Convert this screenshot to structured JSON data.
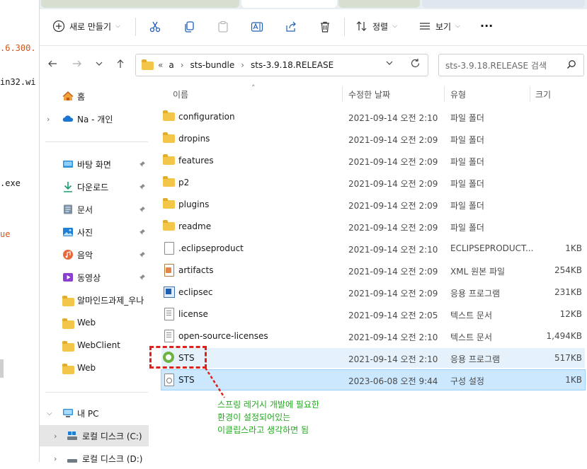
{
  "editor": {
    "lines": [
      {
        "text": ".6.300.",
        "color": "#d1561c"
      },
      {
        "text": "in32.wi",
        "color": "#1a1a1a"
      },
      {
        "text": ".exe",
        "color": "#1a1a1a"
      },
      {
        "text": "ue",
        "color": "#d1561c"
      }
    ]
  },
  "toolbar": {
    "new_label": "새로 만들기",
    "sort_label": "정렬",
    "view_label": "보기",
    "more_label": "···"
  },
  "address": {
    "prefix": "«",
    "crumbs": [
      "a",
      "sts-bundle",
      "sts-3.9.18.RELEASE"
    ],
    "search_placeholder": "sts-3.9.18.RELEASE 검색"
  },
  "sidebar": {
    "home": "홈",
    "cloud": "Na - 개인",
    "quick": [
      {
        "label": "바탕 화면",
        "icon": "desktop-icon",
        "pinned": true
      },
      {
        "label": "다운로드",
        "icon": "download-icon",
        "pinned": true
      },
      {
        "label": "문서",
        "icon": "documents-icon",
        "pinned": true
      },
      {
        "label": "사진",
        "icon": "pictures-icon",
        "pinned": true
      },
      {
        "label": "음악",
        "icon": "music-icon",
        "pinned": true
      },
      {
        "label": "동영상",
        "icon": "videos-icon",
        "pinned": true
      },
      {
        "label": "알마인드과제_우나",
        "icon": "folder-icon",
        "pinned": false
      },
      {
        "label": "Web",
        "icon": "folder-icon",
        "pinned": false
      },
      {
        "label": "WebClient",
        "icon": "folder-icon",
        "pinned": false
      },
      {
        "label": "Web",
        "icon": "folder-icon",
        "pinned": false
      }
    ],
    "this_pc": "내 PC",
    "drive_c": "로컬 디스크 (C:)",
    "drive_d": "로컬 디스크 (D:)"
  },
  "columns": {
    "name": "이름",
    "date": "수정한 날짜",
    "type": "유형",
    "size": "크기"
  },
  "files": [
    {
      "name": "configuration",
      "date": "2021-09-14 오전 2:10",
      "type": "파일 폴더",
      "size": "",
      "icon": "folder-icon"
    },
    {
      "name": "dropins",
      "date": "2021-09-14 오전 2:09",
      "type": "파일 폴더",
      "size": "",
      "icon": "folder-icon"
    },
    {
      "name": "features",
      "date": "2021-09-14 오전 2:09",
      "type": "파일 폴더",
      "size": "",
      "icon": "folder-icon"
    },
    {
      "name": "p2",
      "date": "2021-09-14 오전 2:09",
      "type": "파일 폴더",
      "size": "",
      "icon": "folder-icon"
    },
    {
      "name": "plugins",
      "date": "2021-09-14 오전 2:09",
      "type": "파일 폴더",
      "size": "",
      "icon": "folder-icon"
    },
    {
      "name": "readme",
      "date": "2021-09-14 오전 2:09",
      "type": "파일 폴더",
      "size": "",
      "icon": "folder-icon"
    },
    {
      "name": ".eclipseproduct",
      "date": "2021-09-14 오전 2:10",
      "type": "ECLIPSEPRODUCT...",
      "size": "1KB",
      "icon": "file-icon"
    },
    {
      "name": "artifacts",
      "date": "2021-09-14 오전 2:09",
      "type": "XML 원본 파일",
      "size": "254KB",
      "icon": "xml-file-icon"
    },
    {
      "name": "eclipsec",
      "date": "2021-09-14 오전 2:09",
      "type": "응용 프로그램",
      "size": "231KB",
      "icon": "app-icon"
    },
    {
      "name": "license",
      "date": "2021-09-14 오전 2:05",
      "type": "텍스트 문서",
      "size": "12KB",
      "icon": "text-file-icon"
    },
    {
      "name": "open-source-licenses",
      "date": "2021-09-14 오전 2:10",
      "type": "텍스트 문서",
      "size": "1,494KB",
      "icon": "text-file-icon"
    },
    {
      "name": "STS",
      "date": "2021-09-14 오전 2:10",
      "type": "응용 프로그램",
      "size": "517KB",
      "icon": "spring-icon",
      "state": "hover"
    },
    {
      "name": "STS",
      "date": "2023-06-08 오전 9:44",
      "type": "구성 설정",
      "size": "1KB",
      "icon": "config-file-icon",
      "state": "selected"
    }
  ],
  "annotation": {
    "lines": [
      "스프링 레거시 개발에 필요한",
      "환경이 설정되어있는",
      "이클립스라고 생각하면 됨"
    ],
    "color": "#22a81e",
    "box_color": "#e0201b"
  },
  "colors": {
    "hover_row": "#e5f1fb",
    "selected_row": "#cce8ff",
    "selected_border": "#99d1ff",
    "drive_selected": "#e6e6e6"
  }
}
